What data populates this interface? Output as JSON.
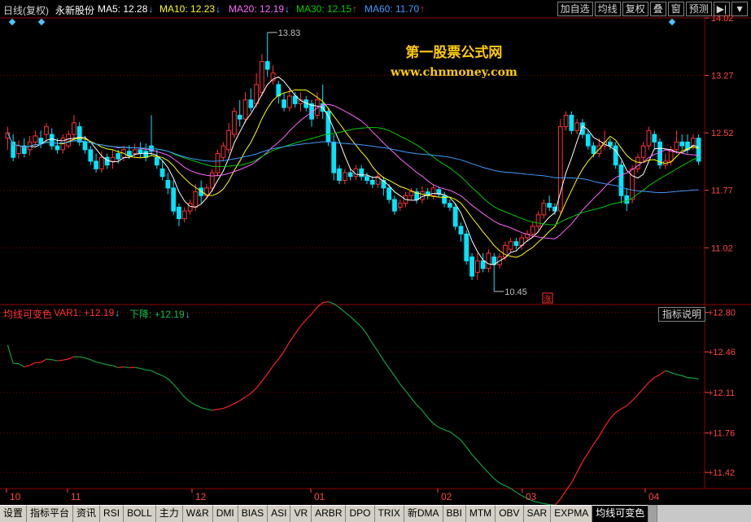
{
  "header": {
    "period": "日线(复权)",
    "stock_name": "永新股份",
    "ma": [
      {
        "label": "MA5:",
        "value": "12.28",
        "dir": "down",
        "color": "#ffffff"
      },
      {
        "label": "MA10:",
        "value": "12.23",
        "dir": "down",
        "color": "#ffff00"
      },
      {
        "label": "MA20:",
        "value": "12.19",
        "dir": "down",
        "color": "#ff66ff"
      },
      {
        "label": "MA30:",
        "value": "12.15",
        "dir": "up",
        "color": "#00cc00"
      },
      {
        "label": "MA60:",
        "value": "11.70",
        "dir": "up",
        "color": "#3d9bff"
      }
    ],
    "toolbar": [
      "加自选",
      "均线",
      "复权",
      "叠",
      "窗",
      "预测"
    ],
    "toolbar_extra": "▶|"
  },
  "watermark": {
    "title": "第一股票公式网",
    "url": "www.chnmoney.com"
  },
  "indicator": {
    "name": "均线可变色",
    "var1_label": "VAR1:",
    "var1_value": "+12.19",
    "down_label": "下降:",
    "down_value": "+12.19",
    "button": "指标说明"
  },
  "tabs": [
    "设置",
    "指标平台",
    "资讯",
    "RSI",
    "BOLL",
    "主力",
    "W&R",
    "DMI",
    "BIAS",
    "ASI",
    "VR",
    "ARBR",
    "DPO",
    "TRIX",
    "新DMA",
    "BBI",
    "MTM",
    "OBV",
    "SAR",
    "EXPMA",
    "均线可变色"
  ],
  "active_tab": "均线可变色",
  "colors": {
    "up": "#ff3333",
    "down": "#00e5ff",
    "grid": "#8b0000",
    "axis_text": "#ff4444"
  },
  "chart_data": [
    {
      "type": "candlestick",
      "title": "",
      "ylim": [
        10.3,
        14.02
      ],
      "y_ticks": [
        14.02,
        13.27,
        12.52,
        11.77,
        11.02
      ],
      "x_ticks": [
        "10",
        "11",
        "12",
        "01",
        "02",
        "03",
        "04"
      ],
      "annotations": {
        "high": "13.83",
        "low": "10.45"
      },
      "candles": [
        [
          12.45,
          12.52,
          12.3,
          12.6
        ],
        [
          12.4,
          12.2,
          12.15,
          12.5
        ],
        [
          12.25,
          12.35,
          12.18,
          12.42
        ],
        [
          12.35,
          12.25,
          12.2,
          12.45
        ],
        [
          12.3,
          12.4,
          12.22,
          12.48
        ],
        [
          12.4,
          12.48,
          12.35,
          12.55
        ],
        [
          12.45,
          12.38,
          12.32,
          12.55
        ],
        [
          12.5,
          12.6,
          12.4,
          12.65
        ],
        [
          12.5,
          12.35,
          12.3,
          12.58
        ],
        [
          12.35,
          12.3,
          12.25,
          12.45
        ],
        [
          12.3,
          12.45,
          12.25,
          12.5
        ],
        [
          12.35,
          12.5,
          12.32,
          12.55
        ],
        [
          12.5,
          12.65,
          12.42,
          12.75
        ],
        [
          12.6,
          12.4,
          12.35,
          12.66
        ],
        [
          12.4,
          12.3,
          12.25,
          12.48
        ],
        [
          12.3,
          12.15,
          12.1,
          12.35
        ],
        [
          12.15,
          12.05,
          12.0,
          12.25
        ],
        [
          12.05,
          12.2,
          12.0,
          12.28
        ],
        [
          12.2,
          12.1,
          12.05,
          12.25
        ],
        [
          12.15,
          12.2,
          12.05,
          12.3
        ],
        [
          12.25,
          12.18,
          12.12,
          12.3
        ],
        [
          12.2,
          12.3,
          12.15,
          12.35
        ],
        [
          12.28,
          12.22,
          12.18,
          12.36
        ],
        [
          12.25,
          12.3,
          12.2,
          12.38
        ],
        [
          12.3,
          12.25,
          12.2,
          12.4
        ],
        [
          12.28,
          12.2,
          12.15,
          12.38
        ],
        [
          12.35,
          12.28,
          12.22,
          12.75
        ],
        [
          12.2,
          12.1,
          12.05,
          12.3
        ],
        [
          12.05,
          11.95,
          11.9,
          12.15
        ],
        [
          11.9,
          11.8,
          11.72,
          12.0
        ],
        [
          11.8,
          11.5,
          11.45,
          11.9
        ],
        [
          11.55,
          11.4,
          11.3,
          11.6
        ],
        [
          11.4,
          11.5,
          11.35,
          11.55
        ],
        [
          11.5,
          11.6,
          11.45,
          11.65
        ],
        [
          11.55,
          11.75,
          11.5,
          11.85
        ],
        [
          11.8,
          11.7,
          11.6,
          11.9
        ],
        [
          11.7,
          11.8,
          11.65,
          11.85
        ],
        [
          11.8,
          12.0,
          11.75,
          12.05
        ],
        [
          12.0,
          12.25,
          11.95,
          12.3
        ],
        [
          12.2,
          12.35,
          12.15,
          12.4
        ],
        [
          12.3,
          12.55,
          12.25,
          12.65
        ],
        [
          12.5,
          12.8,
          12.45,
          12.85
        ],
        [
          12.75,
          12.7,
          12.6,
          12.95
        ],
        [
          12.7,
          12.95,
          12.65,
          13.05
        ],
        [
          12.95,
          12.85,
          12.8,
          13.1
        ],
        [
          12.9,
          13.15,
          12.85,
          13.3
        ],
        [
          13.05,
          13.45,
          13.0,
          13.55
        ],
        [
          13.45,
          13.35,
          13.25,
          13.83
        ],
        [
          13.2,
          13.3,
          13.15,
          13.4
        ],
        [
          13.15,
          13.0,
          12.9,
          13.2
        ],
        [
          12.95,
          12.85,
          12.8,
          13.05
        ],
        [
          12.85,
          13.0,
          12.8,
          13.1
        ],
        [
          13.0,
          12.9,
          12.85,
          13.05
        ],
        [
          12.9,
          12.95,
          12.8,
          13.05
        ],
        [
          12.95,
          12.85,
          12.8,
          13.0
        ],
        [
          12.9,
          12.7,
          12.6,
          12.95
        ],
        [
          12.75,
          12.95,
          12.7,
          13.05
        ],
        [
          12.9,
          12.8,
          12.7,
          13.15
        ],
        [
          12.8,
          12.4,
          12.35,
          12.85
        ],
        [
          12.4,
          12.0,
          11.9,
          12.5
        ],
        [
          12.05,
          11.9,
          11.85,
          12.1
        ],
        [
          11.9,
          12.0,
          11.85,
          12.05
        ],
        [
          12.0,
          11.95,
          11.9,
          12.05
        ],
        [
          11.95,
          12.05,
          11.9,
          12.1
        ],
        [
          12.05,
          11.95,
          11.9,
          12.1
        ],
        [
          11.95,
          11.9,
          11.85,
          12.0
        ],
        [
          11.9,
          11.85,
          11.8,
          11.95
        ],
        [
          11.85,
          11.95,
          11.8,
          12.0
        ],
        [
          11.9,
          11.8,
          11.7,
          11.95
        ],
        [
          11.8,
          11.65,
          11.6,
          11.85
        ],
        [
          11.65,
          11.5,
          11.45,
          11.7
        ],
        [
          11.55,
          11.6,
          11.5,
          11.65
        ],
        [
          11.6,
          11.7,
          11.55,
          11.75
        ],
        [
          11.7,
          11.75,
          11.65,
          11.8
        ],
        [
          11.75,
          11.65,
          11.6,
          11.8
        ],
        [
          11.65,
          11.75,
          11.6,
          11.82
        ],
        [
          11.75,
          11.7,
          11.65,
          11.8
        ],
        [
          11.7,
          11.8,
          11.65,
          11.85
        ],
        [
          11.78,
          11.72,
          11.68,
          11.82
        ],
        [
          11.7,
          11.6,
          11.55,
          11.75
        ],
        [
          11.6,
          11.55,
          11.5,
          11.65
        ],
        [
          11.55,
          11.3,
          11.25,
          11.6
        ],
        [
          11.3,
          11.2,
          11.1,
          11.35
        ],
        [
          11.2,
          10.85,
          10.8,
          11.25
        ],
        [
          10.9,
          10.65,
          10.6,
          10.95
        ],
        [
          10.7,
          10.85,
          10.6,
          10.95
        ],
        [
          10.85,
          10.75,
          10.7,
          10.95
        ],
        [
          10.75,
          10.95,
          10.7,
          11.0
        ],
        [
          10.9,
          10.8,
          10.45,
          10.95
        ],
        [
          10.8,
          10.9,
          10.75,
          10.95
        ],
        [
          10.9,
          11.05,
          10.85,
          11.1
        ],
        [
          11.0,
          11.1,
          10.95,
          11.15
        ],
        [
          11.1,
          11.05,
          11.0,
          11.15
        ],
        [
          11.05,
          11.15,
          11.0,
          11.2
        ],
        [
          11.15,
          11.2,
          11.1,
          11.25
        ],
        [
          11.2,
          11.3,
          11.15,
          11.35
        ],
        [
          11.3,
          11.45,
          11.25,
          11.5
        ],
        [
          11.45,
          11.6,
          11.4,
          11.65
        ],
        [
          11.6,
          11.55,
          11.5,
          11.7
        ],
        [
          11.55,
          11.5,
          11.45,
          11.6
        ],
        [
          11.5,
          12.6,
          11.45,
          12.7
        ],
        [
          12.6,
          12.75,
          12.55,
          12.8
        ],
        [
          12.75,
          12.55,
          12.5,
          12.8
        ],
        [
          12.55,
          12.65,
          12.5,
          12.7
        ],
        [
          12.65,
          12.5,
          12.45,
          12.7
        ],
        [
          12.5,
          12.35,
          12.3,
          12.55
        ],
        [
          12.35,
          12.25,
          12.2,
          12.4
        ],
        [
          12.25,
          12.35,
          12.2,
          12.45
        ],
        [
          12.35,
          12.4,
          12.3,
          12.55
        ],
        [
          12.4,
          12.35,
          12.3,
          12.45
        ],
        [
          12.35,
          12.1,
          12.05,
          12.4
        ],
        [
          12.1,
          11.7,
          11.6,
          12.15
        ],
        [
          11.7,
          11.6,
          11.5,
          11.8
        ],
        [
          11.65,
          12.05,
          11.6,
          12.1
        ],
        [
          12.05,
          12.2,
          12.0,
          12.25
        ],
        [
          12.2,
          12.35,
          12.15,
          12.4
        ],
        [
          12.35,
          12.55,
          12.3,
          12.6
        ],
        [
          12.5,
          12.4,
          12.3,
          12.55
        ],
        [
          12.4,
          12.1,
          12.05,
          12.45
        ],
        [
          12.1,
          12.15,
          12.05,
          12.25
        ],
        [
          12.15,
          12.3,
          12.1,
          12.35
        ],
        [
          12.3,
          12.4,
          12.25,
          12.55
        ],
        [
          12.4,
          12.35,
          12.3,
          12.5
        ],
        [
          12.4,
          12.3,
          12.25,
          12.5
        ],
        [
          12.35,
          12.45,
          12.3,
          12.5
        ],
        [
          12.45,
          12.15,
          12.1,
          12.5
        ]
      ]
    },
    {
      "type": "line",
      "title": "均线可变色",
      "ylim": [
        11.28,
        12.84
      ],
      "y_ticks": [
        "+12.80",
        "+12.46",
        "+12.11",
        "+11.76",
        "+11.42"
      ],
      "series": [
        {
          "name": "VAR1",
          "color": "#ff2020",
          "values": []
        },
        {
          "name": "下降",
          "color": "#10a040",
          "values": []
        }
      ]
    }
  ]
}
